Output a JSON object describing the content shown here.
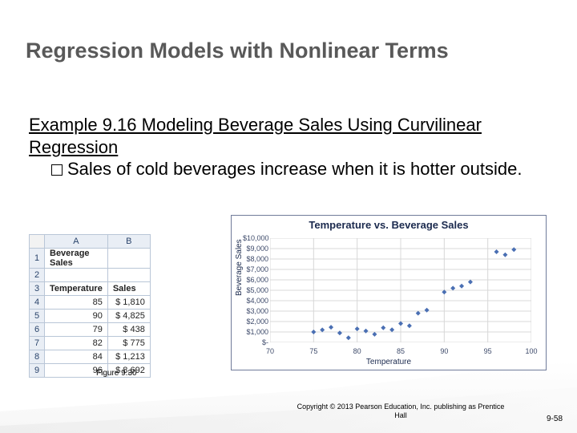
{
  "title": "Regression Models with Nonlinear Terms",
  "example_heading": "Example 9.16  Modeling Beverage Sales Using Curvilinear Regression",
  "bullet_text": "Sales of cold beverages increase when it is hotter outside.",
  "figure_caption": "Figure 9.30",
  "copyright": "Copyright © 2013 Pearson Education, Inc. publishing as Prentice Hall",
  "page_number": "9-58",
  "table": {
    "col_headers": [
      "A",
      "B"
    ],
    "rows": [
      {
        "n": "1",
        "a": "Beverage Sales",
        "b": ""
      },
      {
        "n": "2",
        "a": "",
        "b": ""
      },
      {
        "n": "3",
        "a": "Temperature",
        "b": "Sales"
      },
      {
        "n": "4",
        "a": "85",
        "b": "$    1,810"
      },
      {
        "n": "5",
        "a": "90",
        "b": "$    4,825"
      },
      {
        "n": "6",
        "a": "79",
        "b": "$       438"
      },
      {
        "n": "7",
        "a": "82",
        "b": "$       775"
      },
      {
        "n": "8",
        "a": "84",
        "b": "$    1,213"
      },
      {
        "n": "9",
        "a": "96",
        "b": "$    8,692"
      }
    ]
  },
  "chart_data": {
    "type": "scatter",
    "title": "Temperature vs. Beverage Sales",
    "xlabel": "Temperature",
    "ylabel": "Beverage Sales",
    "xlim": [
      70,
      100
    ],
    "ylim": [
      0,
      10000
    ],
    "xticks": [
      70,
      75,
      80,
      85,
      90,
      95,
      100
    ],
    "yticks": [
      0,
      1000,
      2000,
      3000,
      4000,
      5000,
      6000,
      7000,
      8000,
      9000,
      10000
    ],
    "ytick_labels": [
      "$-",
      "$1,000",
      "$2,000",
      "$3,000",
      "$4,000",
      "$5,000",
      "$6,000",
      "$7,000",
      "$8,000",
      "$9,000",
      "$10,000"
    ],
    "points": [
      {
        "x": 85,
        "y": 1810
      },
      {
        "x": 90,
        "y": 4825
      },
      {
        "x": 79,
        "y": 438
      },
      {
        "x": 82,
        "y": 775
      },
      {
        "x": 84,
        "y": 1213
      },
      {
        "x": 96,
        "y": 8692
      },
      {
        "x": 76,
        "y": 1200
      },
      {
        "x": 78,
        "y": 900
      },
      {
        "x": 80,
        "y": 1300
      },
      {
        "x": 81,
        "y": 1100
      },
      {
        "x": 83,
        "y": 1400
      },
      {
        "x": 86,
        "y": 1600
      },
      {
        "x": 88,
        "y": 3100
      },
      {
        "x": 91,
        "y": 5200
      },
      {
        "x": 92,
        "y": 5400
      },
      {
        "x": 93,
        "y": 5800
      },
      {
        "x": 97,
        "y": 8400
      },
      {
        "x": 98,
        "y": 8900
      },
      {
        "x": 87,
        "y": 2800
      },
      {
        "x": 77,
        "y": 1450
      },
      {
        "x": 75,
        "y": 1000
      }
    ],
    "marker_color": "#4a6fb3"
  }
}
